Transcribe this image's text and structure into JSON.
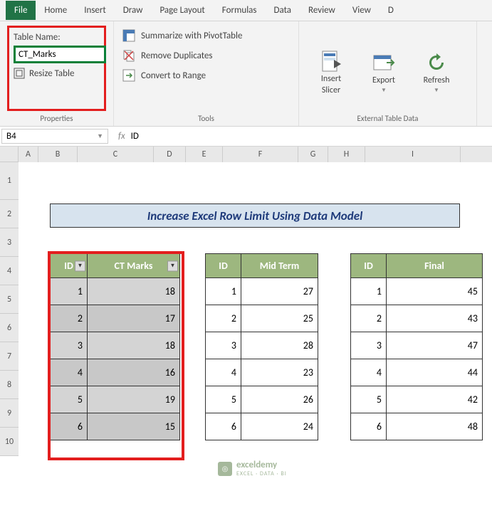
{
  "tabs": [
    "File",
    "Home",
    "Insert",
    "Draw",
    "Page Layout",
    "Formulas",
    "Data",
    "Review",
    "View",
    "D"
  ],
  "ribbon": {
    "properties": {
      "label": "Properties",
      "table_name_label": "Table Name:",
      "table_name_value": "CT_Marks",
      "resize_label": "Resize Table"
    },
    "tools": {
      "label": "Tools",
      "summarize": "Summarize with PivotTable",
      "remove_dup": "Remove Duplicates",
      "convert": "Convert to Range"
    },
    "external": {
      "label": "External Table Data",
      "insert_slicer_l1": "Insert",
      "insert_slicer_l2": "Slicer",
      "export": "Export",
      "refresh": "Refresh"
    }
  },
  "namebox": "B4",
  "formula_value": "ID",
  "columns": [
    {
      "l": "A",
      "w": 28
    },
    {
      "l": "B",
      "w": 55
    },
    {
      "l": "C",
      "w": 107
    },
    {
      "l": "D",
      "w": 45
    },
    {
      "l": "E",
      "w": 52
    },
    {
      "l": "F",
      "w": 106
    },
    {
      "l": "G",
      "w": 42
    },
    {
      "l": "H",
      "w": 52
    },
    {
      "l": "I",
      "w": 134
    }
  ],
  "rows": [
    "1",
    "2",
    "3",
    "4",
    "5",
    "6",
    "7",
    "8",
    "9",
    "10"
  ],
  "title": "Increase Excel Row Limit Using Data Model",
  "table1": {
    "headers": [
      "ID",
      "CT Marks"
    ],
    "rows": [
      [
        1,
        18
      ],
      [
        2,
        17
      ],
      [
        3,
        18
      ],
      [
        4,
        16
      ],
      [
        5,
        19
      ],
      [
        6,
        15
      ]
    ]
  },
  "table2": {
    "headers": [
      "ID",
      "Mid Term"
    ],
    "rows": [
      [
        1,
        27
      ],
      [
        2,
        25
      ],
      [
        3,
        28
      ],
      [
        4,
        23
      ],
      [
        5,
        26
      ],
      [
        6,
        24
      ]
    ]
  },
  "table3": {
    "headers": [
      "ID",
      "Final"
    ],
    "rows": [
      [
        1,
        45
      ],
      [
        2,
        43
      ],
      [
        3,
        47
      ],
      [
        4,
        44
      ],
      [
        5,
        42
      ],
      [
        6,
        48
      ]
    ]
  },
  "watermark": {
    "brand": "exceldemy",
    "tag": "EXCEL · DATA · BI"
  }
}
